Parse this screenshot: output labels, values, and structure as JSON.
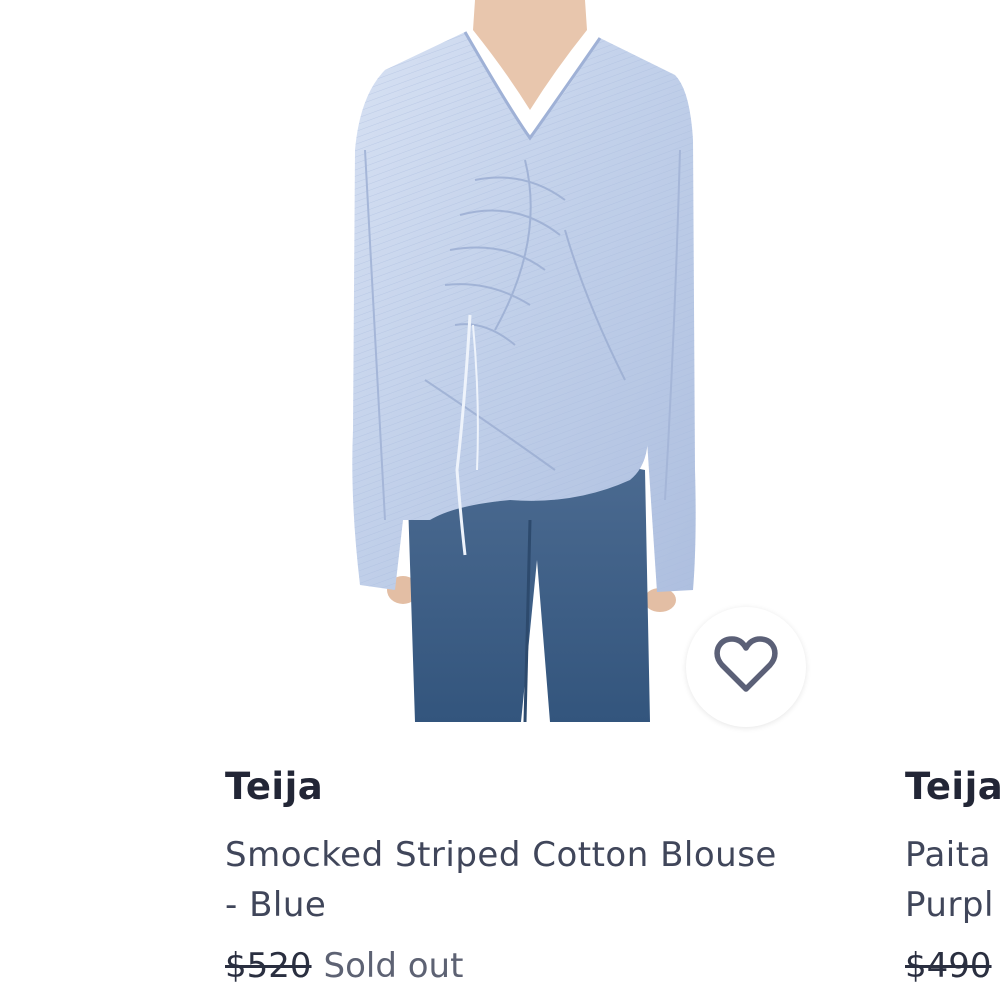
{
  "products": [
    {
      "brand": "Teija",
      "name_line1": "Smocked Striped Cotton Blouse",
      "name_line2": "- Blue",
      "price": "$520",
      "status": "Sold out"
    },
    {
      "brand": "Teija",
      "name_line1": "Paita",
      "name_line2": "Purpl",
      "price": "$490"
    }
  ],
  "icons": {
    "wishlist": "heart-outline-icon"
  },
  "colors": {
    "shirt": "#bccbe6",
    "jeans": "#3f5f86",
    "text_primary": "#222636",
    "text_secondary": "#5d6273",
    "heart": "#5b6077"
  }
}
